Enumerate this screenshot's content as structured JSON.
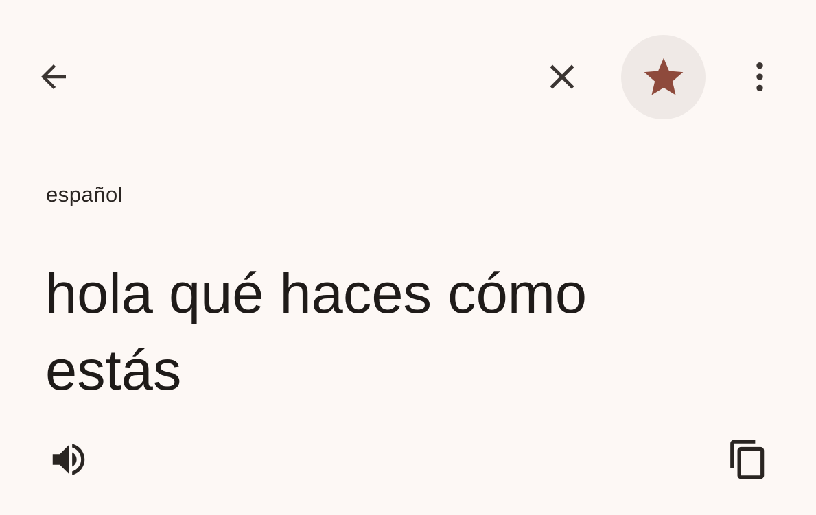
{
  "source": {
    "language_label": "español",
    "text": "hola qué haces cómo estás"
  },
  "icons": {
    "back": "arrow-back-icon",
    "close": "close-icon",
    "star": "star-icon",
    "more": "more-vert-icon",
    "speaker": "volume-up-icon",
    "copy": "copy-icon"
  },
  "colors": {
    "background": "#fdf8f5",
    "text": "#1f1b19",
    "icon": "#3b3532",
    "star_active": "#8e4a3c",
    "star_circle": "#efe9e6"
  }
}
